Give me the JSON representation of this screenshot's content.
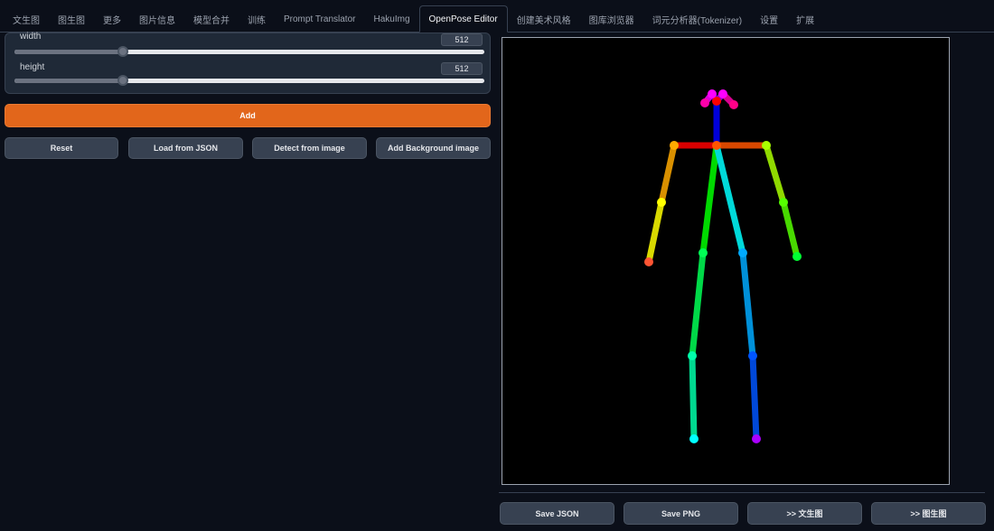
{
  "tabs": [
    {
      "label": "文生图",
      "active": false
    },
    {
      "label": "图生图",
      "active": false
    },
    {
      "label": "更多",
      "active": false
    },
    {
      "label": "图片信息",
      "active": false
    },
    {
      "label": "模型合并",
      "active": false
    },
    {
      "label": "训练",
      "active": false
    },
    {
      "label": "Prompt Translator",
      "active": false
    },
    {
      "label": "HakuImg",
      "active": false
    },
    {
      "label": "OpenPose Editor",
      "active": true
    },
    {
      "label": "创建美术风格",
      "active": false
    },
    {
      "label": "图库浏览器",
      "active": false
    },
    {
      "label": "词元分析器(Tokenizer)",
      "active": false
    },
    {
      "label": "设置",
      "active": false
    },
    {
      "label": "扩展",
      "active": false
    }
  ],
  "width": {
    "label": "width",
    "value": "512",
    "fraction": 0.23
  },
  "height": {
    "label": "height",
    "value": "512",
    "fraction": 0.23
  },
  "buttons": {
    "add": "Add",
    "reset": "Reset",
    "load_json": "Load from JSON",
    "detect": "Detect from image",
    "add_bg": "Add Background image",
    "save_json": "Save JSON",
    "save_png": "Save PNG",
    "send_txt2img": ">> 文生图",
    "send_img2img": ">> 图生图"
  },
  "colors": {
    "accent": "#e2661b",
    "background": "#0b0f19",
    "panel": "#1f2937"
  }
}
